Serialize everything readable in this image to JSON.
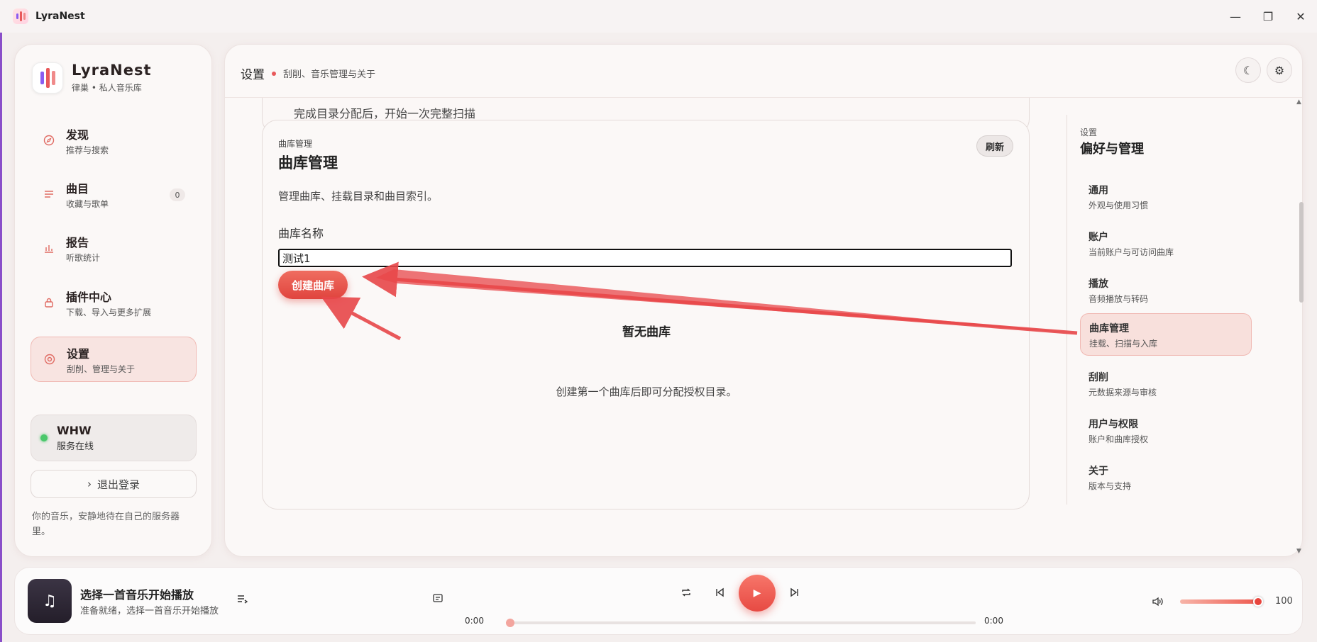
{
  "window": {
    "title": "LyraNest",
    "minimize_icon": "minimize-icon",
    "maximize_icon": "maximize-icon",
    "close_icon": "close-icon"
  },
  "sidebar": {
    "brand_name": "LyraNest",
    "brand_sub": "律巢 • 私人音乐库",
    "items": [
      {
        "title": "发现",
        "sub": "推荐与搜索",
        "icon": "compass-icon"
      },
      {
        "title": "曲目",
        "sub": "收藏与歌单",
        "icon": "list-icon",
        "badge": "0"
      },
      {
        "title": "报告",
        "sub": "听歌统计",
        "icon": "bar-chart-icon"
      },
      {
        "title": "插件中心",
        "sub": "下载、导入与更多扩展",
        "icon": "lock-icon"
      },
      {
        "title": "设置",
        "sub": "刮削、管理与关于",
        "icon": "settings-icon",
        "active": true
      }
    ],
    "server": {
      "name": "WHW",
      "status": "服务在线",
      "status_color": "#4bc86b"
    },
    "logout_label": "退出登录",
    "tagline": "你的音乐，安静地待在自己的服务器里。"
  },
  "main": {
    "title": "设置",
    "subtitle": "刮削、音乐管理与关于",
    "theme_icon": "moon-icon",
    "settings_icon": "gear-icon",
    "prev_card_text": "完成目录分配后，开始一次完整扫描",
    "card": {
      "kicker": "曲库管理",
      "title": "曲库管理",
      "refresh_label": "刷新",
      "description": "管理曲库、挂载目录和曲目索引。",
      "field_label": "曲库名称",
      "field_value": "测试1",
      "create_label": "创建曲库",
      "empty_title": "暂无曲库",
      "empty_desc": "创建第一个曲库后即可分配授权目录。"
    }
  },
  "settings_nav": {
    "kicker": "设置",
    "title": "偏好与管理",
    "items": [
      {
        "title": "通用",
        "sub": "外观与使用习惯"
      },
      {
        "title": "账户",
        "sub": "当前账户与可访问曲库"
      },
      {
        "title": "播放",
        "sub": "音频播放与转码"
      },
      {
        "title": "曲库管理",
        "sub": "挂载、扫描与入库",
        "active": true
      },
      {
        "title": "刮削",
        "sub": "元数据来源与审核"
      },
      {
        "title": "用户与权限",
        "sub": "账户和曲库授权"
      },
      {
        "title": "关于",
        "sub": "版本与支持"
      }
    ]
  },
  "player": {
    "track_title": "选择一首音乐开始播放",
    "track_sub": "准备就绪，选择一首音乐开始播放",
    "time_current": "0:00",
    "time_total": "0:00",
    "progress": 0,
    "volume": "100",
    "accent": "#e74a43"
  }
}
